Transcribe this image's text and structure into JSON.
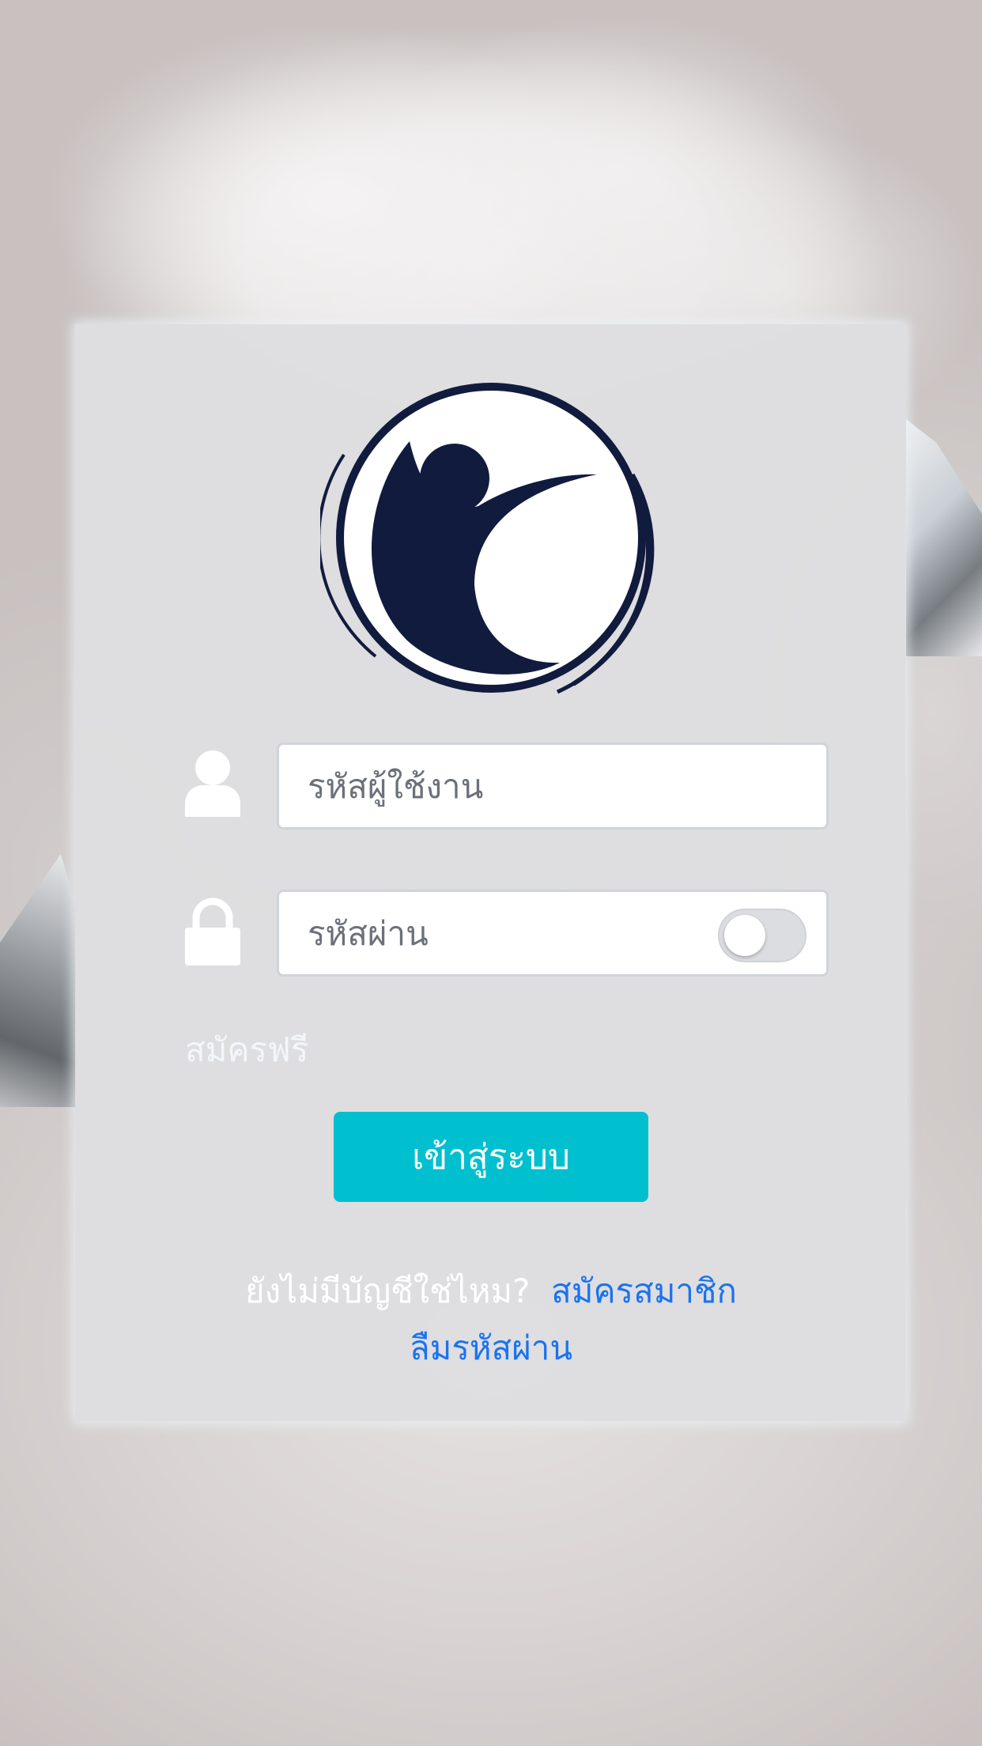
{
  "colors": {
    "accent": "#00c0cf",
    "link": "#1a73f0",
    "logo_navy": "#101b3e",
    "card_bg": "#dedee0"
  },
  "logo": {
    "icon": "person-circle-logo"
  },
  "username": {
    "icon": "user-icon",
    "placeholder": "รหัสผู้ใช้งาน",
    "value": ""
  },
  "password": {
    "icon": "lock-icon",
    "placeholder": "รหัสผ่าน",
    "value": "",
    "show_toggle_on": false
  },
  "free_signup_link": "สมัครฟรี",
  "login_button": "เข้าสู่ระบบ",
  "footer": {
    "no_account_text": "ยังไม่มีบัญชีใช่ไหม?",
    "register_link": "สมัครสมาชิก",
    "forgot_password_link": "ลืมรหัสผ่าน"
  }
}
